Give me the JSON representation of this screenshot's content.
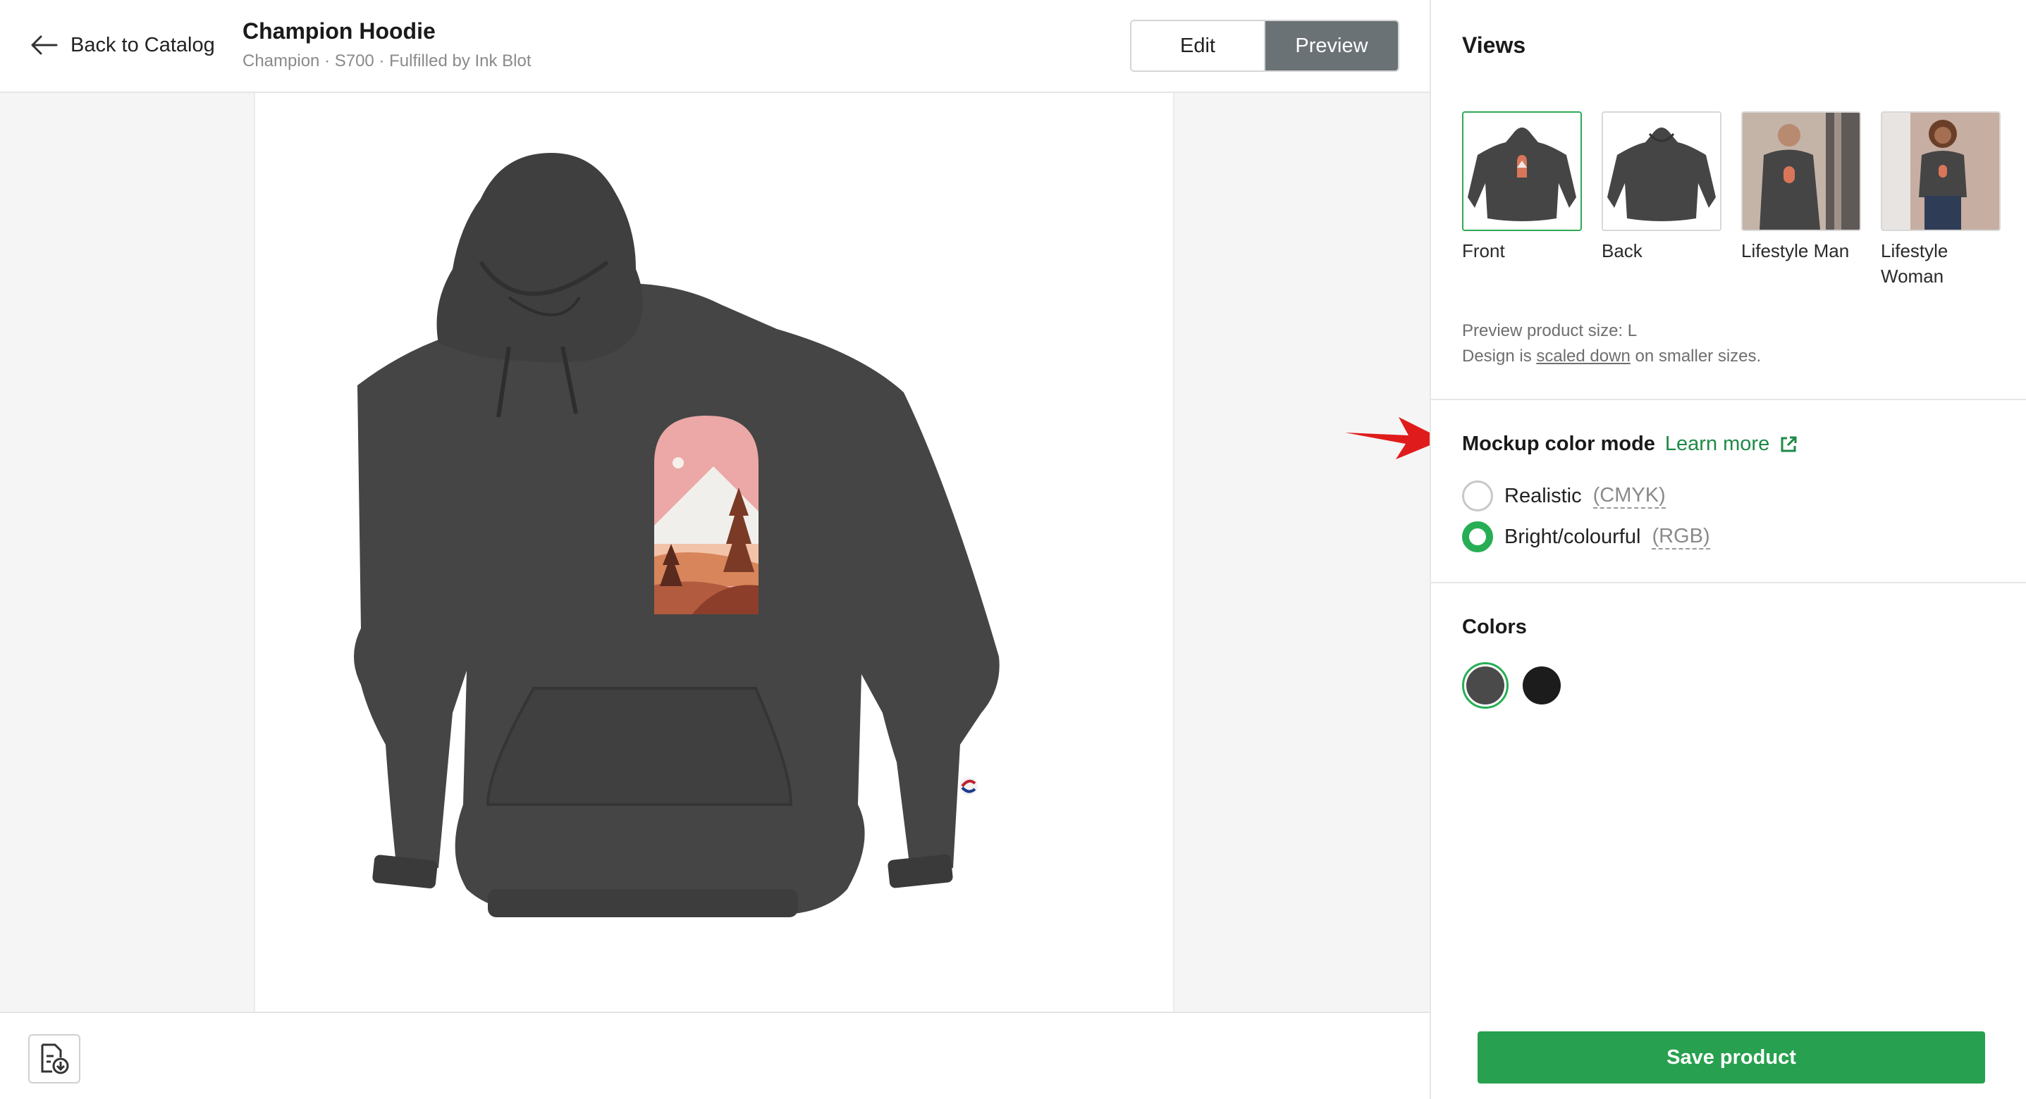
{
  "header": {
    "back_label": "Back to Catalog",
    "title": "Champion Hoodie",
    "subtitle": "Champion · S700 · Fulfilled by Ink Blot",
    "tabs": [
      {
        "label": "Edit",
        "active": false
      },
      {
        "label": "Preview",
        "active": true
      }
    ]
  },
  "canvas": {
    "product_color": "#454545",
    "design": "mountain-arch-landscape"
  },
  "sidebar": {
    "views_title": "Views",
    "views": [
      {
        "label": "Front",
        "selected": true
      },
      {
        "label": "Back",
        "selected": false
      },
      {
        "label": "Lifestyle Man",
        "selected": false
      },
      {
        "label": "Lifestyle Woman",
        "selected": false
      }
    ],
    "size_line1": "Preview product size: L",
    "size_line2_pre": "Design is ",
    "size_line2_link": "scaled down",
    "size_line2_post": " on smaller sizes.",
    "mode_title": "Mockup color mode",
    "learn_more": "Learn more",
    "modes": [
      {
        "label": "Realistic",
        "note": "(CMYK)",
        "selected": false
      },
      {
        "label": "Bright/colourful",
        "note": "(RGB)",
        "selected": true
      }
    ],
    "colors_title": "Colors",
    "colors": [
      {
        "hex": "#4a4a4a",
        "selected": true
      },
      {
        "hex": "#1c1c1c",
        "selected": false
      }
    ],
    "save_label": "Save product"
  },
  "theme": {
    "accent": "#27a04f",
    "annotation_arrow": "#e01b1b"
  }
}
